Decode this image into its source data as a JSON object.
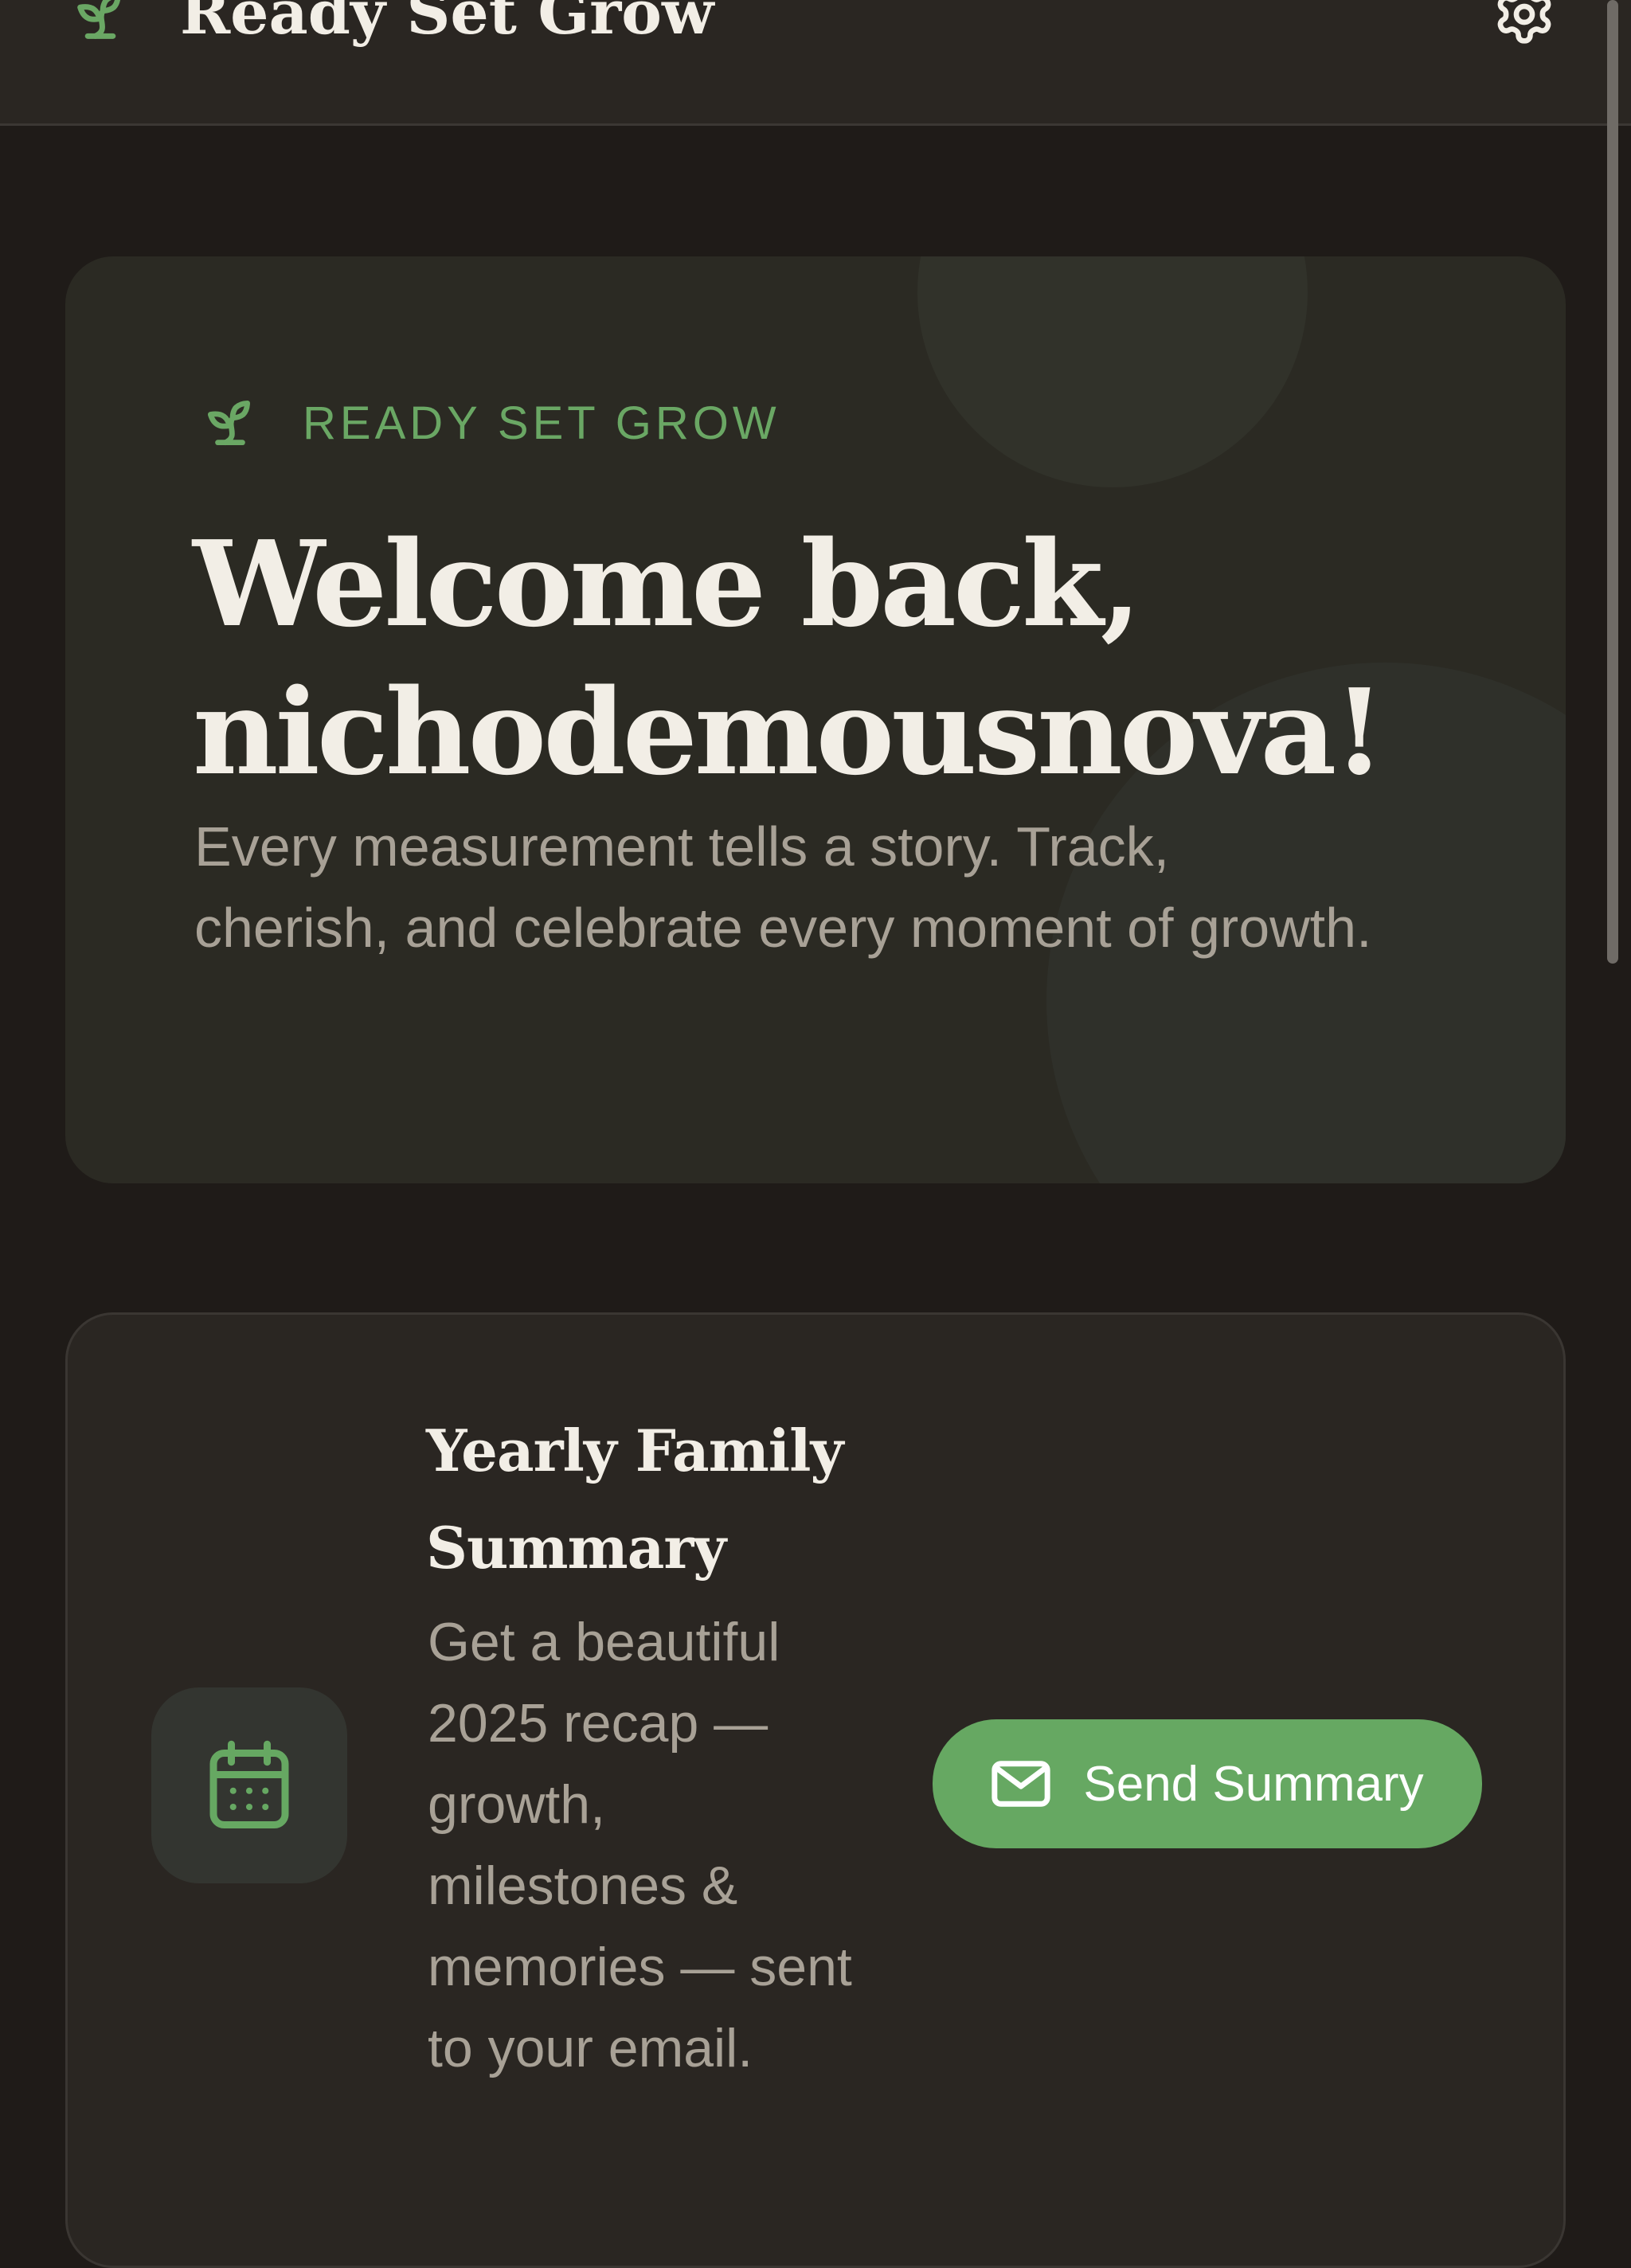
{
  "app": {
    "title": "Ready Set Grow"
  },
  "topbar": {
    "logo_icon": "sprout-icon",
    "settings_icon": "gear-icon"
  },
  "hero": {
    "brand_icon": "sprout-icon",
    "brand_label": "READY SET GROW",
    "title_line1": "Welcome back,",
    "title_line2": "nichodemousnova!",
    "subtitle": "Every measurement tells a story. Track, cherish, and celebrate every moment of growth."
  },
  "summary": {
    "icon": "calendar-icon",
    "title": "Yearly Family Summary",
    "description": "Get a beautiful 2025 recap — growth, milestones & memories — sent to your email.",
    "button_icon": "mail-icon",
    "button_label": "Send Summary"
  },
  "colors": {
    "background": "#1f1b18",
    "topbar": "#2a2622",
    "hero_card": "#2b2a23",
    "summary_card": "#2a2622",
    "accent_green": "#66a862",
    "heading_text": "#f2eee6",
    "muted_text": "#a8a196"
  }
}
